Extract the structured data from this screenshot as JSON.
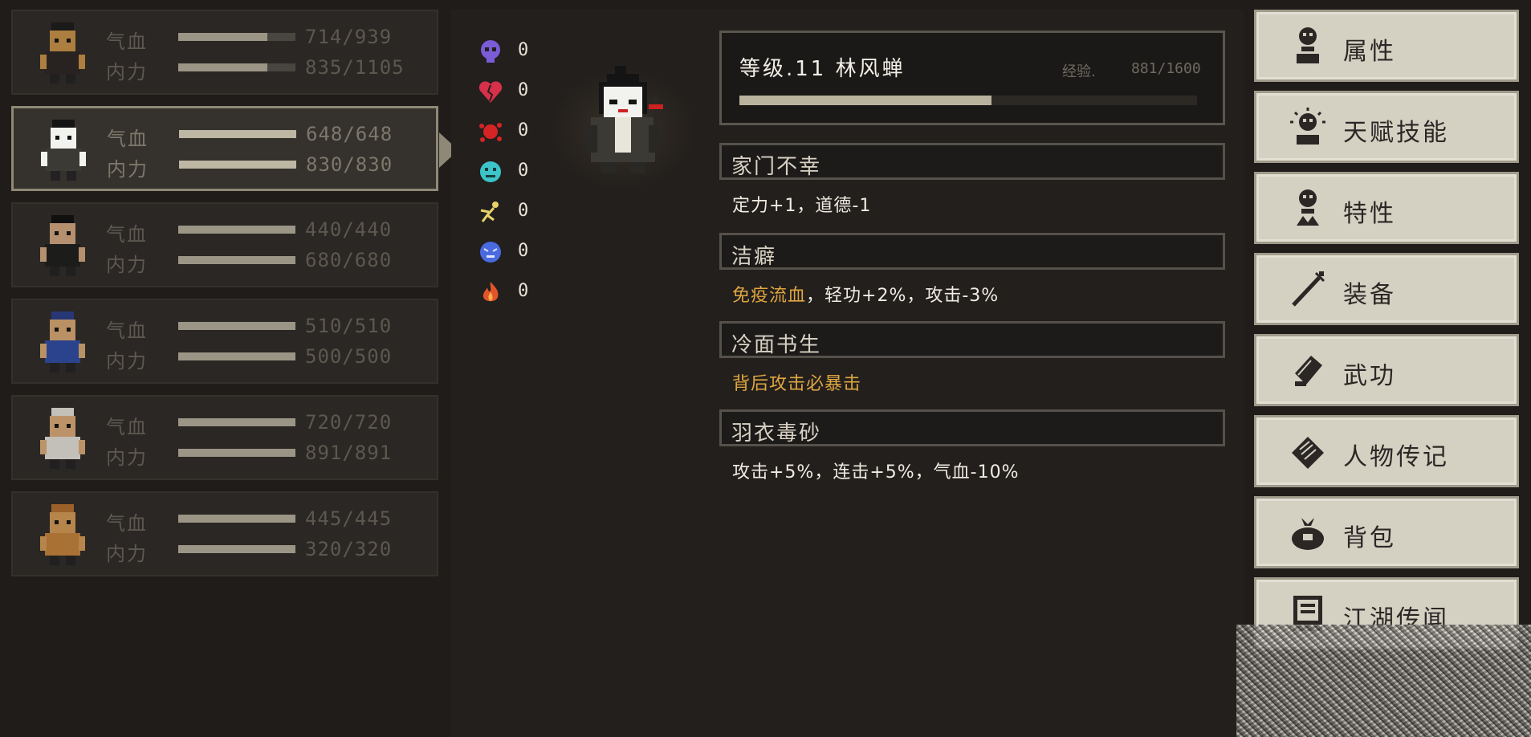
{
  "party": [
    {
      "hp_label": "气血",
      "hp": "714/939",
      "hp_frac": 0.76,
      "mp_label": "内力",
      "mp": "835/1105",
      "mp_frac": 0.76,
      "active": false,
      "colors": {
        "skin": "#d49a4a",
        "cloth": "#2b2622",
        "hair": "#1a1a1a"
      }
    },
    {
      "hp_label": "气血",
      "hp": "648/648",
      "hp_frac": 1.0,
      "mp_label": "内力",
      "mp": "830/830",
      "mp_frac": 1.0,
      "active": true,
      "colors": {
        "skin": "#f2f2ee",
        "cloth": "#3c3a34",
        "hair": "#141414"
      }
    },
    {
      "hp_label": "气血",
      "hp": "440/440",
      "hp_frac": 1.0,
      "mp_label": "内力",
      "mp": "680/680",
      "mp_frac": 1.0,
      "active": false,
      "colors": {
        "skin": "#e0b188",
        "cloth": "#1c1c1c",
        "hair": "#0d0d0d"
      }
    },
    {
      "hp_label": "气血",
      "hp": "510/510",
      "hp_frac": 1.0,
      "mp_label": "内力",
      "mp": "500/500",
      "mp_frac": 1.0,
      "active": false,
      "colors": {
        "skin": "#e6b37a",
        "cloth": "#2f4fae",
        "hair": "#2a3f90"
      }
    },
    {
      "hp_label": "气血",
      "hp": "720/720",
      "hp_frac": 1.0,
      "mp_label": "内力",
      "mp": "891/891",
      "mp_frac": 1.0,
      "active": false,
      "colors": {
        "skin": "#e8b57e",
        "cloth": "#f0eee6",
        "hair": "#f0eee6"
      }
    },
    {
      "hp_label": "气血",
      "hp": "445/445",
      "hp_frac": 1.0,
      "mp_label": "内力",
      "mp": "320/320",
      "mp_frac": 1.0,
      "active": false,
      "colors": {
        "skin": "#e1a35b",
        "cloth": "#d08a3c",
        "hair": "#c07530"
      }
    }
  ],
  "resistances": [
    {
      "icon": "skull-icon",
      "value": "0",
      "color": "#7a5cd6"
    },
    {
      "icon": "broken-heart-icon",
      "value": "0",
      "color": "#d6304a"
    },
    {
      "icon": "blood-splat-icon",
      "value": "0",
      "color": "#d42424"
    },
    {
      "icon": "poison-face-icon",
      "value": "0",
      "color": "#3cc4c8"
    },
    {
      "icon": "stunned-figure-icon",
      "value": "0",
      "color": "#e8d36a"
    },
    {
      "icon": "frost-face-icon",
      "value": "0",
      "color": "#4a6ae0"
    },
    {
      "icon": "flame-icon",
      "value": "0",
      "color": "#e2542a"
    }
  ],
  "character": {
    "level_title": "等级.11  林风蝉",
    "exp_label": "经验.",
    "exp_value": "881/1600",
    "exp_frac": 0.55
  },
  "traits": [
    {
      "name": "家门不幸",
      "desc_plain": "定力+1，道德-1",
      "desc_gold": ""
    },
    {
      "name": "洁癖",
      "desc_gold": "免疫流血",
      "desc_plain": "，轻功+2%，攻击-3%"
    },
    {
      "name": "冷面书生",
      "desc_gold": "背后攻击必暴击",
      "desc_plain": ""
    },
    {
      "name": "羽衣毒砂",
      "desc_plain": "攻击+5%，连击+5%，气血-10%",
      "desc_gold": ""
    }
  ],
  "menu": [
    {
      "label": "属性",
      "icon": "character-silhouette-icon"
    },
    {
      "label": "天赋技能",
      "icon": "radiant-head-icon"
    },
    {
      "label": "特性",
      "icon": "character-trait-icon"
    },
    {
      "label": "装备",
      "icon": "sword-icon"
    },
    {
      "label": "武功",
      "icon": "martial-book-icon"
    },
    {
      "label": "人物传记",
      "icon": "scroll-icon"
    },
    {
      "label": "背包",
      "icon": "bag-icon"
    },
    {
      "label": "江湖传闻",
      "icon": "notice-board-icon"
    }
  ],
  "colors": {
    "accent_gold": "#e0a640",
    "panel": "#221f1d",
    "menu_bg": "#d4d0c2"
  }
}
